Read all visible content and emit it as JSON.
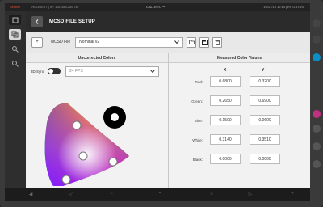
{
  "status": {
    "service": "Service",
    "network": "RUGGETT | IP: 192.168.200.78",
    "brand": "CALLISTO™",
    "right": "10/17/18   12:14 pm   STATUS"
  },
  "header": {
    "title": "MCSD FILE SETUP"
  },
  "file_row": {
    "label": "MCSD File",
    "selected": "Nominal v2",
    "add_label": "+"
  },
  "left_panel": {
    "title": "Uncorrected Colors",
    "sync_label": "3D Sync",
    "fps_value": "24 FPS"
  },
  "right_panel": {
    "title": "Measured Color Values",
    "col_x": "X",
    "col_y": "Y",
    "rows": [
      {
        "label": "Red:",
        "x": "0.6800",
        "y": "0.3200"
      },
      {
        "label": "Green:",
        "x": "0.2650",
        "y": "0.6900"
      },
      {
        "label": "Blue:",
        "x": "0.1500",
        "y": "0.0600"
      },
      {
        "label": "White:",
        "x": "0.3140",
        "y": "0.3510"
      },
      {
        "label": "Black:",
        "x": "0.0000",
        "y": "0.0000"
      }
    ]
  },
  "icons": {
    "back": "chevron-left-icon",
    "dropdown": "chevron-down-icon",
    "open": "folder-icon",
    "save": "save-icon",
    "delete": "trash-icon"
  }
}
